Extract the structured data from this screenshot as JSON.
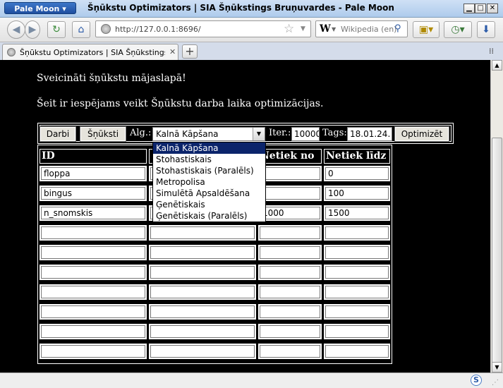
{
  "browser": {
    "app_button": "Pale Moon",
    "window_title": "Šņūkstu Optimizators | SIA Šņūkstings Bruņuvardes - Pale Moon",
    "url": "http://127.0.0.1:8696/",
    "search_placeholder": "Wikipedia (en)",
    "tab_title": "Šņūkstu Optimizators | SIA Šņūkstings Br...",
    "new_tab": "+"
  },
  "page": {
    "greeting": "Sveicināti šņūkstu mājaslapā!",
    "description": "Šeit ir iespējams veikt Šņūkstu darba laika optimizācijas.",
    "toolbar": {
      "darbi_label": "Darbi",
      "snuksti_label": "Šņūksti",
      "alg_label": "Alg.:",
      "alg_selected": "Kalnā Kāpšana",
      "iter_label": "Iter.:",
      "iter_value": "10000",
      "tags_label": "Tags:",
      "tags_value": "18.01.24.",
      "optimize_label": "Optimizēt"
    },
    "table": {
      "headers": [
        "ID",
        "",
        "Netiek no",
        "Netiek līdz"
      ],
      "rows": [
        [
          "floppa",
          "",
          "",
          "0"
        ],
        [
          "bingus",
          "",
          "",
          "100"
        ],
        [
          "n_snomskis",
          "",
          "1000",
          "1500"
        ],
        [
          "",
          "",
          "",
          ""
        ],
        [
          "",
          "",
          "",
          ""
        ],
        [
          "",
          "",
          "",
          ""
        ],
        [
          "",
          "",
          "",
          ""
        ],
        [
          "",
          "",
          "",
          ""
        ],
        [
          "",
          "",
          "",
          ""
        ],
        [
          "",
          "",
          "",
          ""
        ]
      ]
    },
    "algorithm_options": [
      "Kalnā Kāpšana",
      "Stohastiskais",
      "Stohastiskais (Paralēls)",
      "Metropolisa",
      "Simulētā Apsaldēšana",
      "Ģenētiskais",
      "Ģenētiskais (Paralēls)"
    ]
  },
  "icons": {
    "back": "back-icon",
    "forward": "forward-icon",
    "reload": "reload-icon",
    "home": "home-icon",
    "bookmark": "bookmark-star-icon",
    "search": "search-icon",
    "downloads": "download-icon",
    "history": "history-icon"
  }
}
